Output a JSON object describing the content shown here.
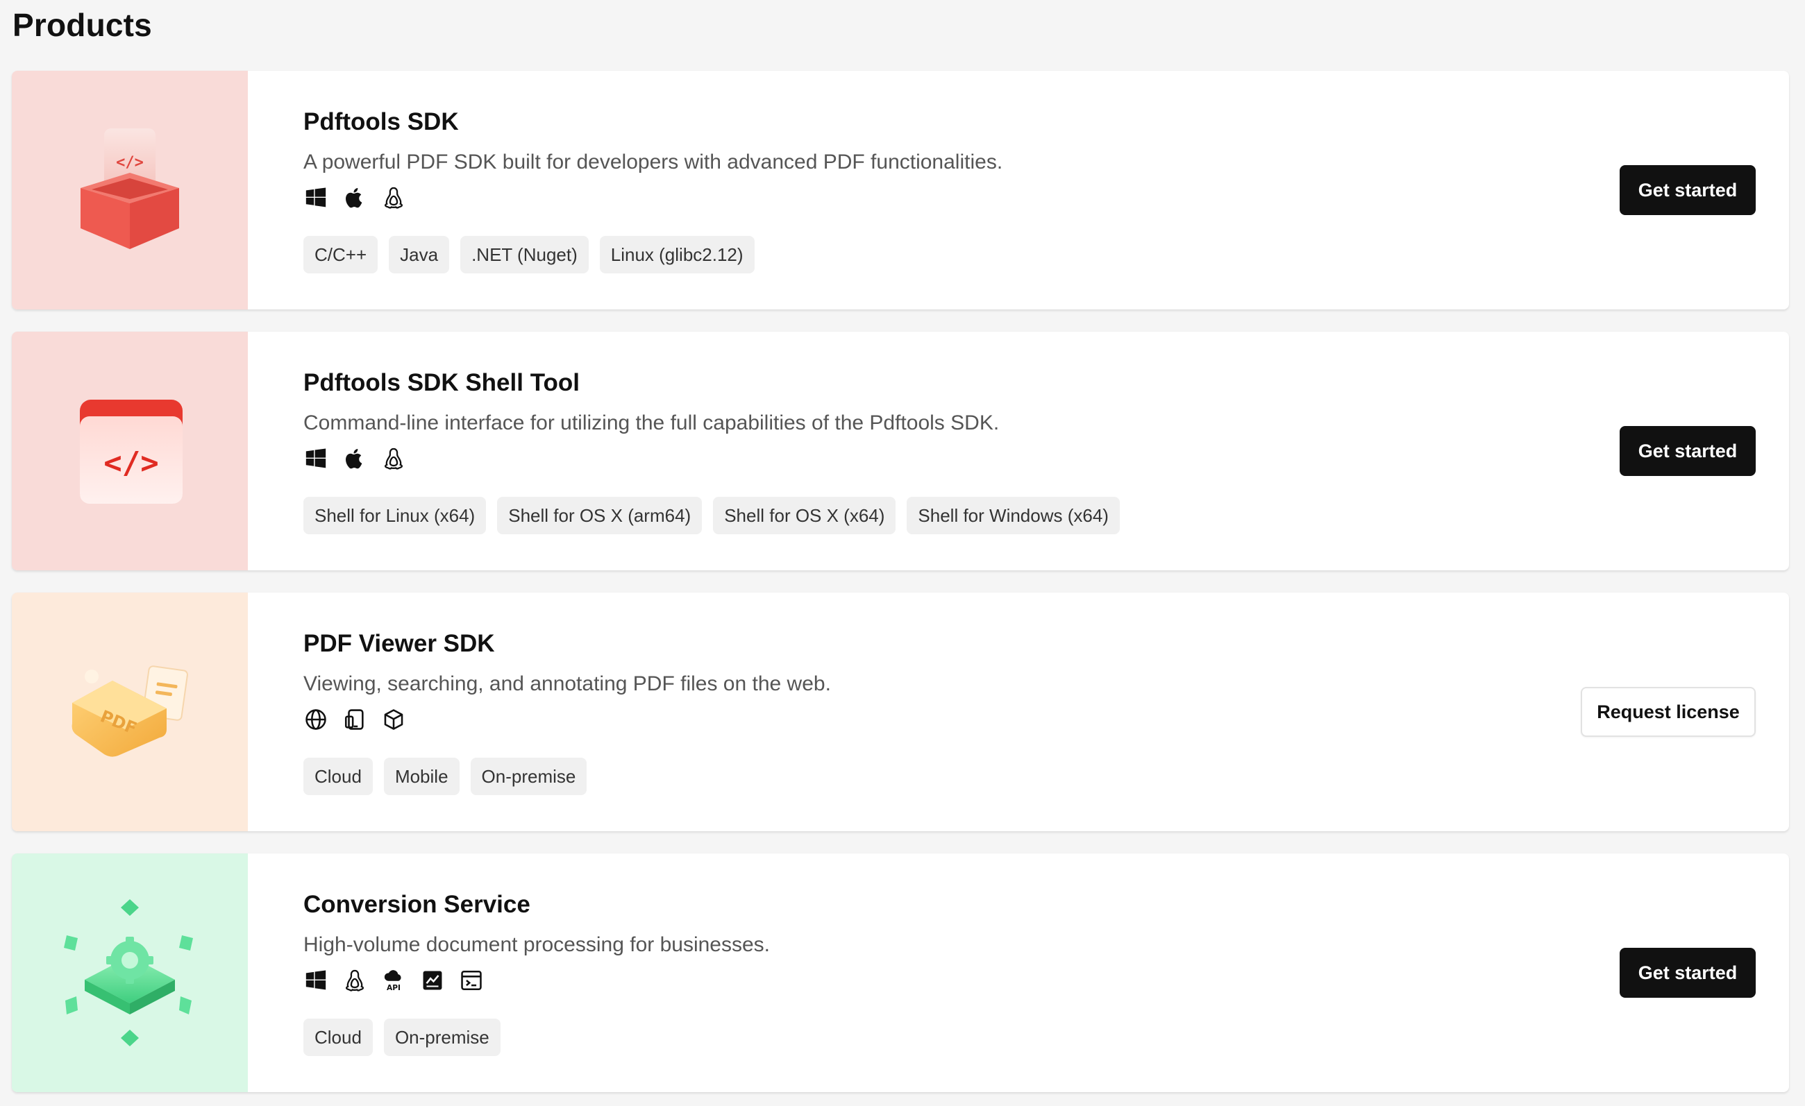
{
  "page": {
    "title": "Products"
  },
  "colors": {
    "thumb_red": "#f9dbd8",
    "thumb_peach": "#fdeadb",
    "thumb_green": "#d9f8e6",
    "button_dark": "#111111",
    "tag_bg": "#f0f0f0"
  },
  "products": [
    {
      "title": "Pdftools SDK",
      "description": "A powerful PDF SDK built for developers with advanced PDF functionalities.",
      "platform_icons": [
        "windows-icon",
        "apple-icon",
        "linux-icon"
      ],
      "tags": [
        "C/C++",
        "Java",
        ".NET (Nuget)",
        "Linux (glibc2.12)"
      ],
      "action": "Get started"
    },
    {
      "title": "Pdftools SDK Shell Tool",
      "description": "Command-line interface for utilizing the full capabilities of the Pdftools SDK.",
      "platform_icons": [
        "windows-icon",
        "apple-icon",
        "linux-icon"
      ],
      "tags": [
        "Shell for Linux (x64)",
        "Shell for OS X (arm64)",
        "Shell for OS X (x64)",
        "Shell for Windows (x64)"
      ],
      "action": "Get started"
    },
    {
      "title": "PDF Viewer SDK",
      "description": "Viewing, searching, and annotating PDF files on the web.",
      "platform_icons": [
        "globe-icon",
        "mobile-icon",
        "cube-icon"
      ],
      "tags": [
        "Cloud",
        "Mobile",
        "On-premise"
      ],
      "action": "Request license"
    },
    {
      "title": "Conversion Service",
      "description": "High-volume document processing for businesses.",
      "platform_icons": [
        "windows-icon",
        "linux-icon",
        "cloud-api-icon",
        "chart-icon",
        "terminal-icon"
      ],
      "tags": [
        "Cloud",
        "On-premise"
      ],
      "action": "Get started"
    }
  ]
}
